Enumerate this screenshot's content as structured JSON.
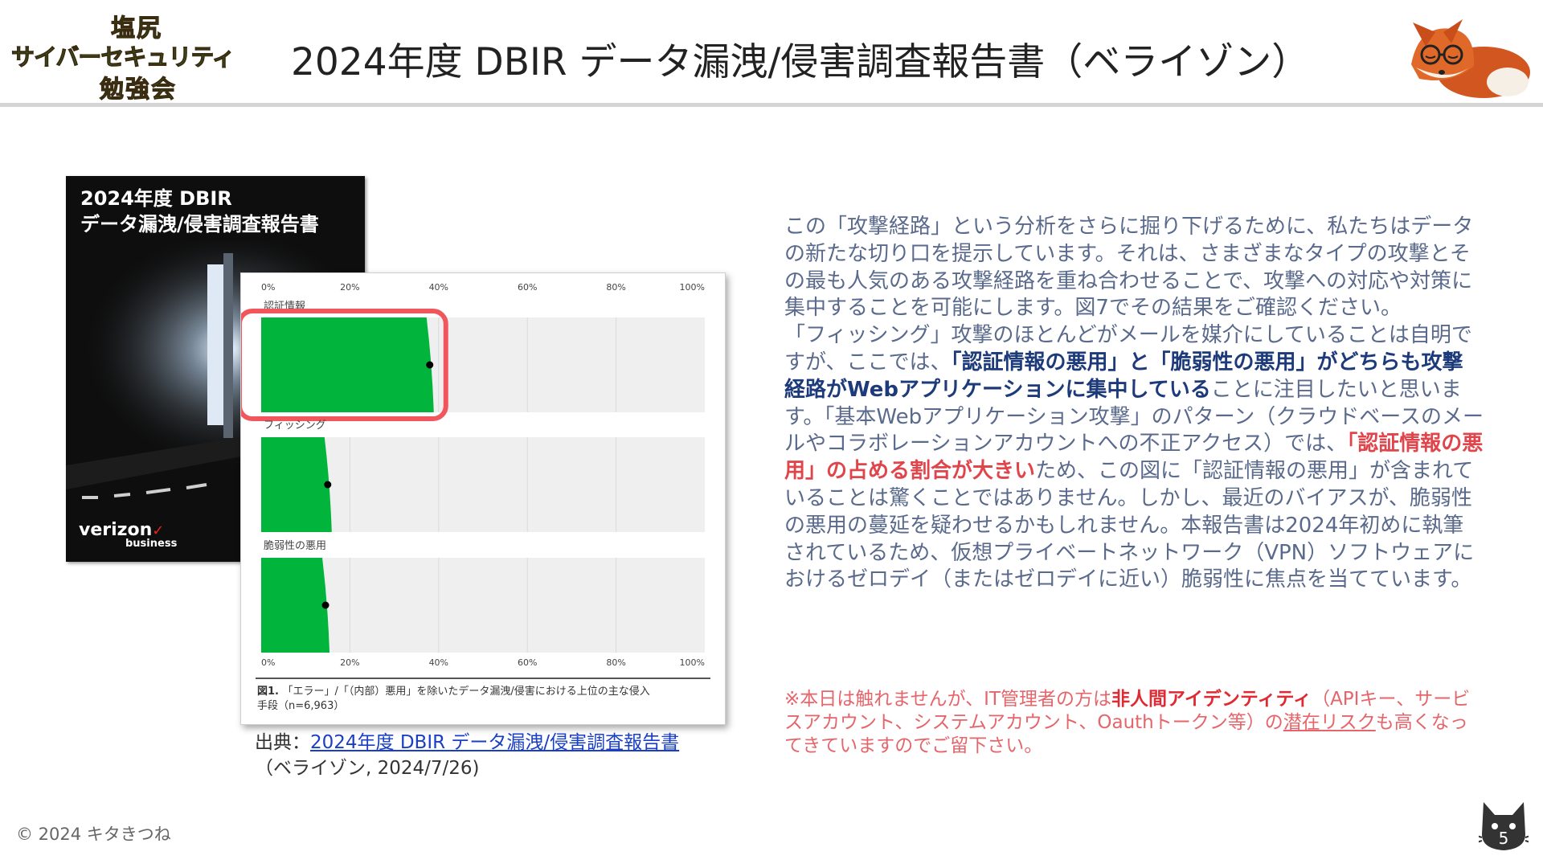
{
  "header": {
    "logo_line1": "塩尻",
    "logo_line2": "サイバーセキュリティ",
    "logo_line3": "勉強会",
    "title": "2024年度 DBIR データ漏洩/侵害調査報告書（ベライゾン）",
    "mascot_icon": "fox-mascot-icon"
  },
  "cover": {
    "title_line1": "2024年度 DBIR",
    "title_line2": "データ漏洩/侵害調査報告書",
    "brand": "verizon",
    "brand_check": "✓",
    "brand_sub": "business"
  },
  "chart_data": {
    "type": "bar",
    "orientation": "horizontal",
    "categories": [
      "認証情報",
      "フィッシング",
      "脆弱性の悪用"
    ],
    "values": [
      38,
      15,
      14.5
    ],
    "xlim": [
      0,
      100
    ],
    "x_ticks": [
      "0%",
      "20%",
      "40%",
      "60%",
      "80%",
      "100%"
    ],
    "bar_color": "#00b43c",
    "highlight_category": "認証情報",
    "highlight_color": "#f0565c",
    "caption_label": "図1.",
    "caption_line1": "「エラー」/「（内部）悪用」を除いたデータ漏洩/侵害における上位の主な侵入",
    "caption_line2": "手段（n=6,963）"
  },
  "source": {
    "prefix": "出典：",
    "link_text": "2024年度 DBIR データ漏洩/侵害調査報告書",
    "suffix": "（ベライゾン, 2024/7/26)"
  },
  "body": {
    "p1": "この「攻撃経路」という分析をさらに掘り下げるために、私たちはデータの新たな切り口を提示しています。それは、さまざまなタイプの攻撃とその最も人気のある攻撃経路を重ね合わせることで、攻撃への対応や対策に集中することを可能にします。図7でその結果をご確認ください。",
    "p2_a": "「フィッシング」攻撃のほとんどがメールを媒介にしていることは自明ですが、ここでは、",
    "p2_b": "「認証情報の悪用」と「脆弱性の悪用」がどちらも攻撃経路がWebアプリケーションに集中している",
    "p2_c": "ことに注目したいと思います。「基本Webアプリケーション攻撃」のパターン（クラウドベースのメールやコラボレーションアカウントへの不正アクセス）では、",
    "p2_d": "「認証情報の悪用」の占める割合が大きい",
    "p2_e": "ため、この図に「認証情報の悪用」が含まれていることは驚くことではありません。しかし、最近のバイアスが、脆弱性の悪用の蔓延を疑わせるかもしれません。本報告書は2024年初めに執筆されているため、仮想プライベートネットワーク（VPN）ソフトウェアにおけるゼロデイ（またはゼロデイに近い）脆弱性に焦点を当てています。"
  },
  "note": {
    "a": "※本日は触れませんが、IT管理者の方は",
    "b": "非人間アイデンティティ",
    "c": "（APIキー、サービスアカウント、システムアカウント、Oauthトークン等）の",
    "d": "潜在リスク",
    "e": "も高くなってきていますのでご留下さい。"
  },
  "footer": {
    "copyright": "© 2024 キタきつね",
    "page_number": "5"
  }
}
